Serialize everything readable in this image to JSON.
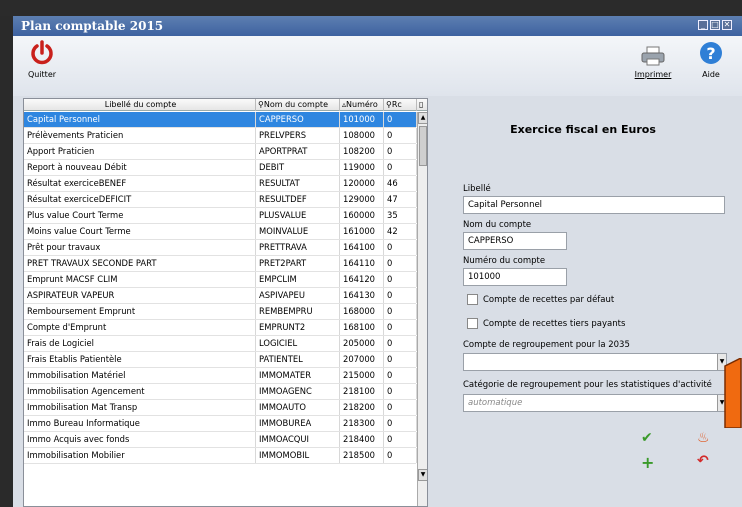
{
  "window": {
    "title": "Plan comptable 2015"
  },
  "toolbar": {
    "quit_label": "Quitter",
    "print_label": "Imprimer",
    "help_label": "Aide"
  },
  "grid": {
    "headers": {
      "libelle": "Libellé du compte",
      "nom": "Nom du compte",
      "numero": "Numéro",
      "rc": "Rc"
    },
    "rows": [
      {
        "libelle": "Capital Personnel",
        "nom": "CAPPERSO",
        "numero": "101000",
        "rc": "0"
      },
      {
        "libelle": "Prélèvements Praticien",
        "nom": "PRELVPERS",
        "numero": "108000",
        "rc": "0"
      },
      {
        "libelle": "Apport Praticien",
        "nom": "APORTPRAT",
        "numero": "108200",
        "rc": "0"
      },
      {
        "libelle": "Report à nouveau Débit",
        "nom": "DEBIT",
        "numero": "119000",
        "rc": "0"
      },
      {
        "libelle": "Résultat exerciceBENEF",
        "nom": "RESULTAT",
        "numero": "120000",
        "rc": "46"
      },
      {
        "libelle": "Résultat exerciceDEFICIT",
        "nom": "RESULTDEF",
        "numero": "129000",
        "rc": "47"
      },
      {
        "libelle": "Plus value Court Terme",
        "nom": "PLUSVALUE",
        "numero": "160000",
        "rc": "35"
      },
      {
        "libelle": "Moins value Court Terme",
        "nom": "MOINVALUE",
        "numero": "161000",
        "rc": "42"
      },
      {
        "libelle": "Prêt pour travaux",
        "nom": "PRETTRAVA",
        "numero": "164100",
        "rc": "0"
      },
      {
        "libelle": "PRET TRAVAUX SECONDE PART",
        "nom": "PRET2PART",
        "numero": "164110",
        "rc": "0"
      },
      {
        "libelle": "Emprunt MACSF CLIM",
        "nom": "EMPCLIM",
        "numero": "164120",
        "rc": "0"
      },
      {
        "libelle": "ASPIRATEUR VAPEUR",
        "nom": "ASPIVAPEU",
        "numero": "164130",
        "rc": "0"
      },
      {
        "libelle": "Remboursement Emprunt",
        "nom": "REMBEMPRU",
        "numero": "168000",
        "rc": "0"
      },
      {
        "libelle": "Compte d'Emprunt",
        "nom": "EMPRUNT2",
        "numero": "168100",
        "rc": "0"
      },
      {
        "libelle": "Frais de Logiciel",
        "nom": "LOGICIEL",
        "numero": "205000",
        "rc": "0"
      },
      {
        "libelle": "Frais Etablis Patientèle",
        "nom": "PATIENTEL",
        "numero": "207000",
        "rc": "0"
      },
      {
        "libelle": "Immobilisation Matériel",
        "nom": "IMMOMATER",
        "numero": "215000",
        "rc": "0"
      },
      {
        "libelle": "Immobilisation Agencement",
        "nom": "IMMOAGENC",
        "numero": "218100",
        "rc": "0"
      },
      {
        "libelle": "Immobilisation Mat Transp",
        "nom": "IMMOAUTO",
        "numero": "218200",
        "rc": "0"
      },
      {
        "libelle": "Immo Bureau Informatique",
        "nom": "IMMOBUREA",
        "numero": "218300",
        "rc": "0"
      },
      {
        "libelle": "Immo Acquis avec fonds",
        "nom": "IMMOACQUI",
        "numero": "218400",
        "rc": "0"
      },
      {
        "libelle": "Immobilisation Mobilier",
        "nom": "IMMOMOBIL",
        "numero": "218500",
        "rc": "0"
      }
    ]
  },
  "panel": {
    "title": "Exercice fiscal en Euros",
    "libelle_label": "Libellé",
    "libelle_value": "Capital Personnel",
    "nom_label": "Nom du compte",
    "nom_value": "CAPPERSO",
    "numero_label": "Numéro du compte",
    "numero_value": "101000",
    "chk1_label": "Compte de recettes par défaut",
    "chk2_label": "Compte de recettes tiers payants",
    "regroup_label": "Compte de regroupement pour la 2035",
    "regroup_value": "",
    "categorie_label": "Catégorie de regroupement pour les statistiques d'activité",
    "categorie_placeholder": "automatique"
  },
  "colors": {
    "title_bar": "#4a6ea9",
    "selection": "#2e86e0",
    "quit_icon": "#c9201b",
    "help_icon": "#2f7fd6",
    "validate": "#3a9a2a",
    "delete": "#e0541b"
  }
}
